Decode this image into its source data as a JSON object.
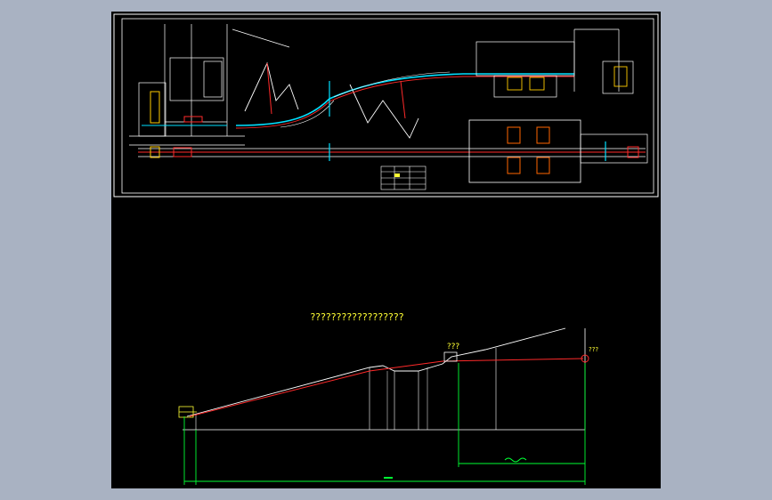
{
  "colors": {
    "background": "#a9b2c2",
    "canvas": "#000000",
    "line": "#ffffff",
    "pipe": "#ff2a2a",
    "dimension": "#00ff33",
    "water": "#00e0ff",
    "label": "#ffff33"
  },
  "profile": {
    "title": "??????????????????",
    "station_label": "???",
    "end_label": "???"
  }
}
